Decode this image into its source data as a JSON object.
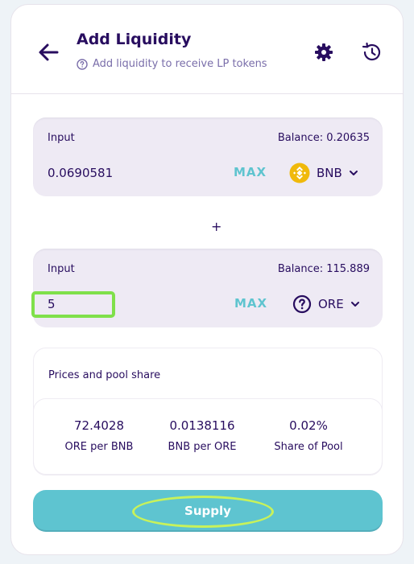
{
  "header": {
    "title": "Add Liquidity",
    "subtitle": "Add liquidity to receive LP tokens",
    "icons": [
      "arrow-left-icon",
      "gear-icon",
      "history-icon",
      "question-circle-icon"
    ]
  },
  "input_a": {
    "label": "Input",
    "balance": "Balance: 0.20635",
    "value": "0.0690581",
    "max_label": "MAX",
    "token": "BNB",
    "token_icon": "bnb-icon"
  },
  "plus_sign": "+",
  "input_b": {
    "label": "Input",
    "balance": "Balance: 115.889",
    "value": "5",
    "max_label": "MAX",
    "token": "ORE",
    "token_icon": "question-circle-icon"
  },
  "prices": {
    "title": "Prices and pool share",
    "stats": [
      {
        "value": "72.4028",
        "label": "ORE per BNB"
      },
      {
        "value": "0.0138116",
        "label": "BNB per ORE"
      },
      {
        "value": "0.02%",
        "label": "Share of Pool"
      }
    ]
  },
  "supply": {
    "label": "Supply"
  },
  "colors": {
    "primary_text": "#280d5f",
    "secondary_text": "#7a6eaa",
    "accent": "#5ec4d0",
    "bnb": "#f0b90b",
    "highlight": "#7fe04a"
  }
}
